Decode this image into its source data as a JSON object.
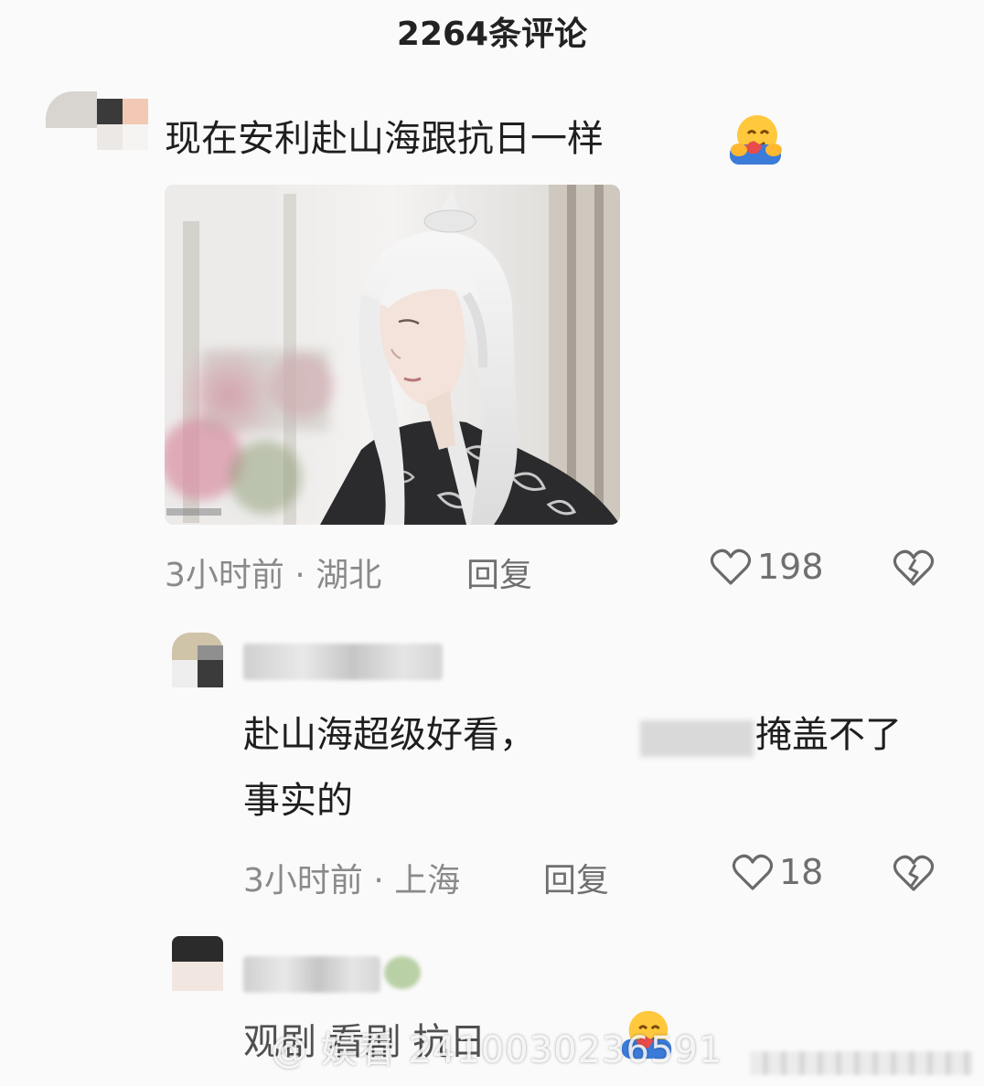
{
  "header": {
    "title": "2264条评论"
  },
  "comments": [
    {
      "text": "现在安利赴山海跟抗日一样",
      "emoji": "hugging-face",
      "time_location": "3小时前 · 湖北",
      "reply_label": "回复",
      "likes": "198"
    },
    {
      "text_line1_a": "赴山海超级好看，",
      "text_line1_b": "掩盖不了",
      "text_line2": "事实的",
      "time_location": "3小时前 · 上海",
      "reply_label": "回复",
      "likes": "18"
    },
    {
      "text_partial": "观剧 看剧 抗日",
      "emoji": "hugging-face"
    }
  ],
  "watermark": {
    "text": "@ 娱看 2410030236591"
  },
  "colors": {
    "background": "#fafafa",
    "meta": "#8a8a8a",
    "text": "#1e1e1e"
  }
}
